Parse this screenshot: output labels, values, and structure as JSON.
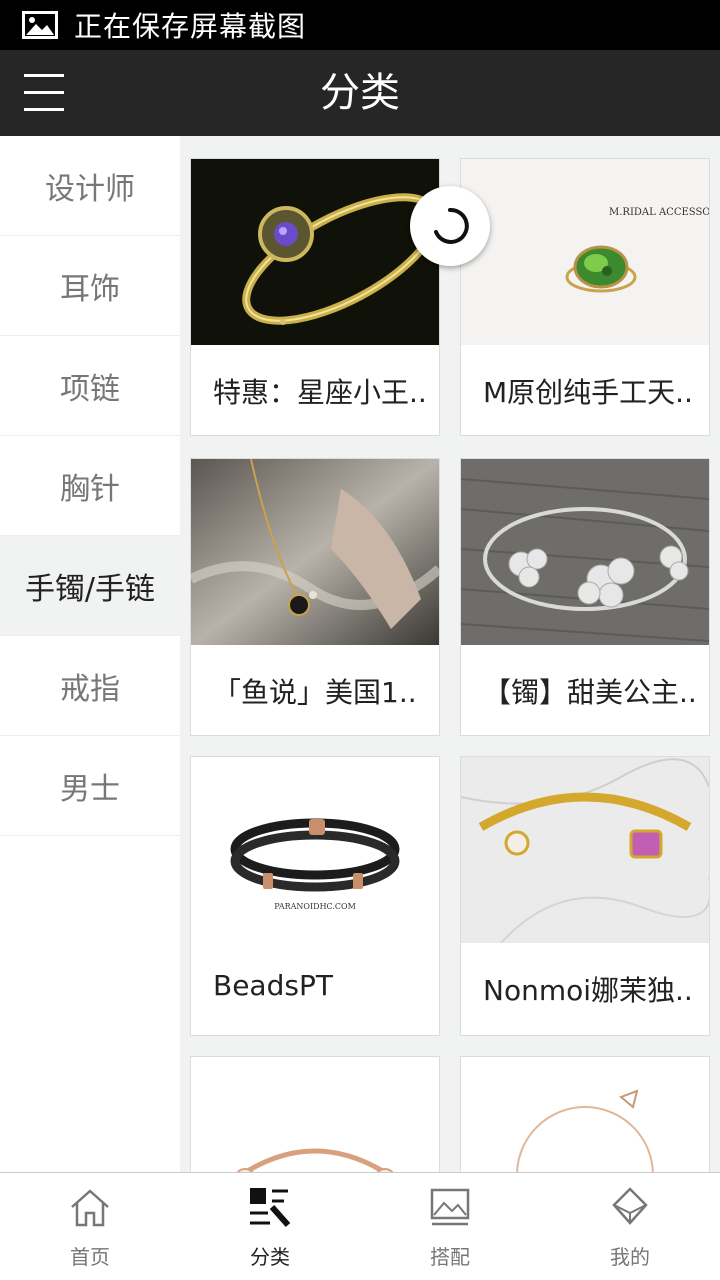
{
  "status_bar": {
    "text": "正在保存屏幕截图",
    "icon": "image-icon"
  },
  "header": {
    "title": "分类",
    "menu_icon": "menu-icon"
  },
  "sidebar": {
    "items": [
      {
        "label": "设计师",
        "active": false
      },
      {
        "label": "耳饰",
        "active": false
      },
      {
        "label": "项链",
        "active": false
      },
      {
        "label": "胸针",
        "active": false
      },
      {
        "label": "手镯/手链",
        "active": true
      },
      {
        "label": "戒指",
        "active": false
      },
      {
        "label": "男士",
        "active": false
      }
    ]
  },
  "products": [
    {
      "name": "特惠：星座小王..",
      "image": "gold-bangle-amethyst"
    },
    {
      "name": "M原创纯手工天..",
      "image": "green-stone-ring",
      "image_caption": "M.RIDAL ACCESSORIES"
    },
    {
      "name": "「鱼说」美国1..",
      "image": "necklace-on-hand"
    },
    {
      "name": "【镯】甜美公主..",
      "image": "silver-flower-bangle"
    },
    {
      "name": "BeadsPT",
      "image": "black-leather-bracelet",
      "image_caption": "PARANOIDHC.COM"
    },
    {
      "name": "Nonmoi娜茉独..",
      "image": "gold-cuff-pearl-crystal"
    },
    {
      "name": "",
      "image": "rose-gold-pearl-cuff"
    },
    {
      "name": "",
      "image": "thin-gold-arrow-bangle"
    }
  ],
  "tabbar": {
    "tabs": [
      {
        "label": "首页",
        "icon": "home-icon",
        "active": false
      },
      {
        "label": "分类",
        "icon": "category-icon",
        "active": true
      },
      {
        "label": "搭配",
        "icon": "picture-icon",
        "active": false
      },
      {
        "label": "我的",
        "icon": "diamond-icon",
        "active": false
      }
    ]
  },
  "colors": {
    "header_bg": "#262626",
    "status_bg": "#000000",
    "content_bg": "#f1f3f2",
    "active_side_bg": "#f1f3f2"
  }
}
